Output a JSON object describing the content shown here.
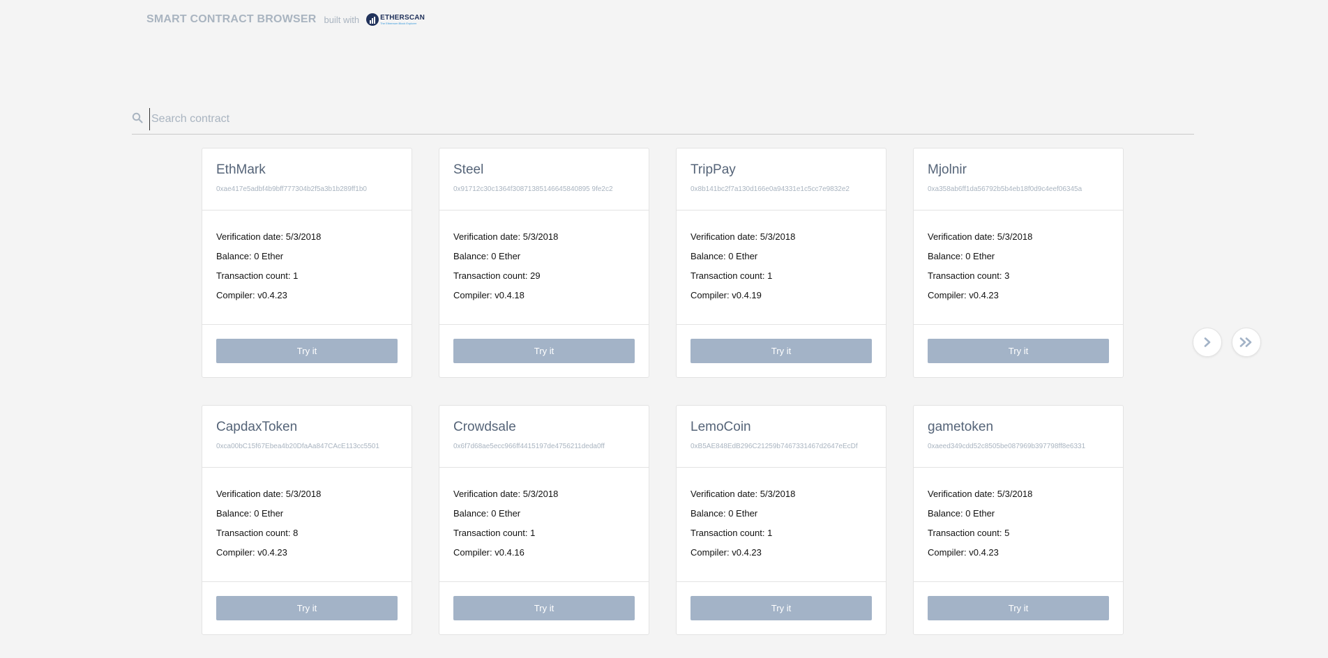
{
  "header": {
    "brand": "SMART CONTRACT BROWSER",
    "built_with": "built with",
    "logo_name": "ETHERSCAN",
    "logo_tagline": "The Ethereum Block Explorer"
  },
  "search": {
    "placeholder": "Search contract",
    "value": ""
  },
  "card_labels": {
    "verification": "Verification date:",
    "balance": "Balance:",
    "tx_count": "Transaction count:",
    "compiler": "Compiler:",
    "button": "Try it"
  },
  "contracts": [
    {
      "name": "EthMark",
      "address": "0xae417e5adbf4b9bff777304b2f5a3b1b289ff1b0",
      "verification_date": "5/3/2018",
      "balance": "0 Ether",
      "tx_count": "1",
      "compiler": "v0.4.23"
    },
    {
      "name": "Steel",
      "address": "0x91712c30c1364f30871385146645840895 9fe2c2",
      "verification_date": "5/3/2018",
      "balance": "0 Ether",
      "tx_count": "29",
      "compiler": "v0.4.18"
    },
    {
      "name": "TripPay",
      "address": "0x8b141bc2f7a130d166e0a94331e1c5cc7e9832e2",
      "verification_date": "5/3/2018",
      "balance": "0 Ether",
      "tx_count": "1",
      "compiler": "v0.4.19"
    },
    {
      "name": "Mjolnir",
      "address": "0xa358ab6ff1da56792b5b4eb18f0d9c4eef06345a",
      "verification_date": "5/3/2018",
      "balance": "0 Ether",
      "tx_count": "3",
      "compiler": "v0.4.23"
    },
    {
      "name": "CapdaxToken",
      "address": "0xca00bC15f67Ebea4b20DfaAa847CAcE113cc5501",
      "verification_date": "5/3/2018",
      "balance": "0 Ether",
      "tx_count": "8",
      "compiler": "v0.4.23"
    },
    {
      "name": "Crowdsale",
      "address": "0x6f7d68ae5ecc966ff4415197de4756211deda0ff",
      "verification_date": "5/3/2018",
      "balance": "0 Ether",
      "tx_count": "1",
      "compiler": "v0.4.16"
    },
    {
      "name": "LemoCoin",
      "address": "0xB5AE848EdB296C21259b7467331467d2647eEcDf",
      "verification_date": "5/3/2018",
      "balance": "0 Ether",
      "tx_count": "1",
      "compiler": "v0.4.23"
    },
    {
      "name": "gametoken",
      "address": "0xaeed349cdd52c8505be087969b397798ff8e6331",
      "verification_date": "5/3/2018",
      "balance": "0 Ether",
      "tx_count": "5",
      "compiler": "v0.4.23"
    }
  ],
  "pagination": {
    "next_icon": "chevron-right-icon",
    "last_icon": "double-chevron-right-icon"
  },
  "colors": {
    "background": "#f4f4f4",
    "button": "#a3b3c7",
    "muted_text": "#a9b4c0",
    "title_text": "#556478"
  }
}
